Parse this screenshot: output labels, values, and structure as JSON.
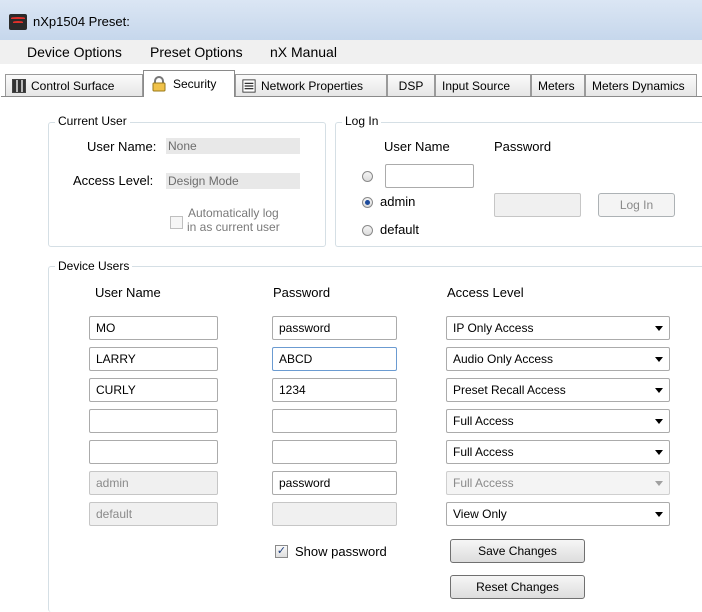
{
  "window": {
    "title": "nXp1504   Preset:"
  },
  "menu": [
    "Device Options",
    "Preset Options",
    "nX Manual"
  ],
  "tabs": [
    {
      "label": "Control Surface",
      "icon": "control-surface-icon"
    },
    {
      "label": "Security",
      "icon": "lock-icon",
      "active": true
    },
    {
      "label": "Network Properties",
      "icon": "network-icon"
    },
    {
      "label": "DSP"
    },
    {
      "label": "Input Source"
    },
    {
      "label": "Meters"
    },
    {
      "label": "Meters Dynamics"
    }
  ],
  "current_user": {
    "group_title": "Current User",
    "user_name_label": "User Name:",
    "user_name_value": "None",
    "access_level_label": "Access Level:",
    "access_level_value": "Design Mode",
    "auto_login_line1": "Automatically log",
    "auto_login_line2": "in as current user"
  },
  "login": {
    "group_title": "Log In",
    "user_name_header": "User Name",
    "password_header": "Password",
    "option_admin": "admin",
    "option_default": "default",
    "custom_user_value": "",
    "password_value": "",
    "login_button": "Log In"
  },
  "device_users": {
    "group_title": "Device Users",
    "headers": {
      "user_name": "User Name",
      "password": "Password",
      "access_level": "Access Level"
    },
    "rows": [
      {
        "user": "MO",
        "password": "password",
        "access": "IP Only Access"
      },
      {
        "user": "LARRY",
        "password": "ABCD",
        "access": "Audio Only Access"
      },
      {
        "user": "CURLY",
        "password": "1234",
        "access": "Preset Recall Access"
      },
      {
        "user": "",
        "password": "",
        "access": "Full Access"
      },
      {
        "user": "",
        "password": "",
        "access": "Full Access"
      },
      {
        "user": "admin",
        "password": "password",
        "access": "Full Access"
      },
      {
        "user": "default",
        "password": "",
        "access": "View Only"
      }
    ],
    "show_password_label": "Show password",
    "save_button": "Save Changes",
    "reset_button": "Reset Changes"
  },
  "colors": {
    "accent": "#1c4a9c",
    "group_border": "#d5dfe5",
    "titlebar_top": "#dbe6f4",
    "titlebar_bottom": "#c4d5ea"
  }
}
